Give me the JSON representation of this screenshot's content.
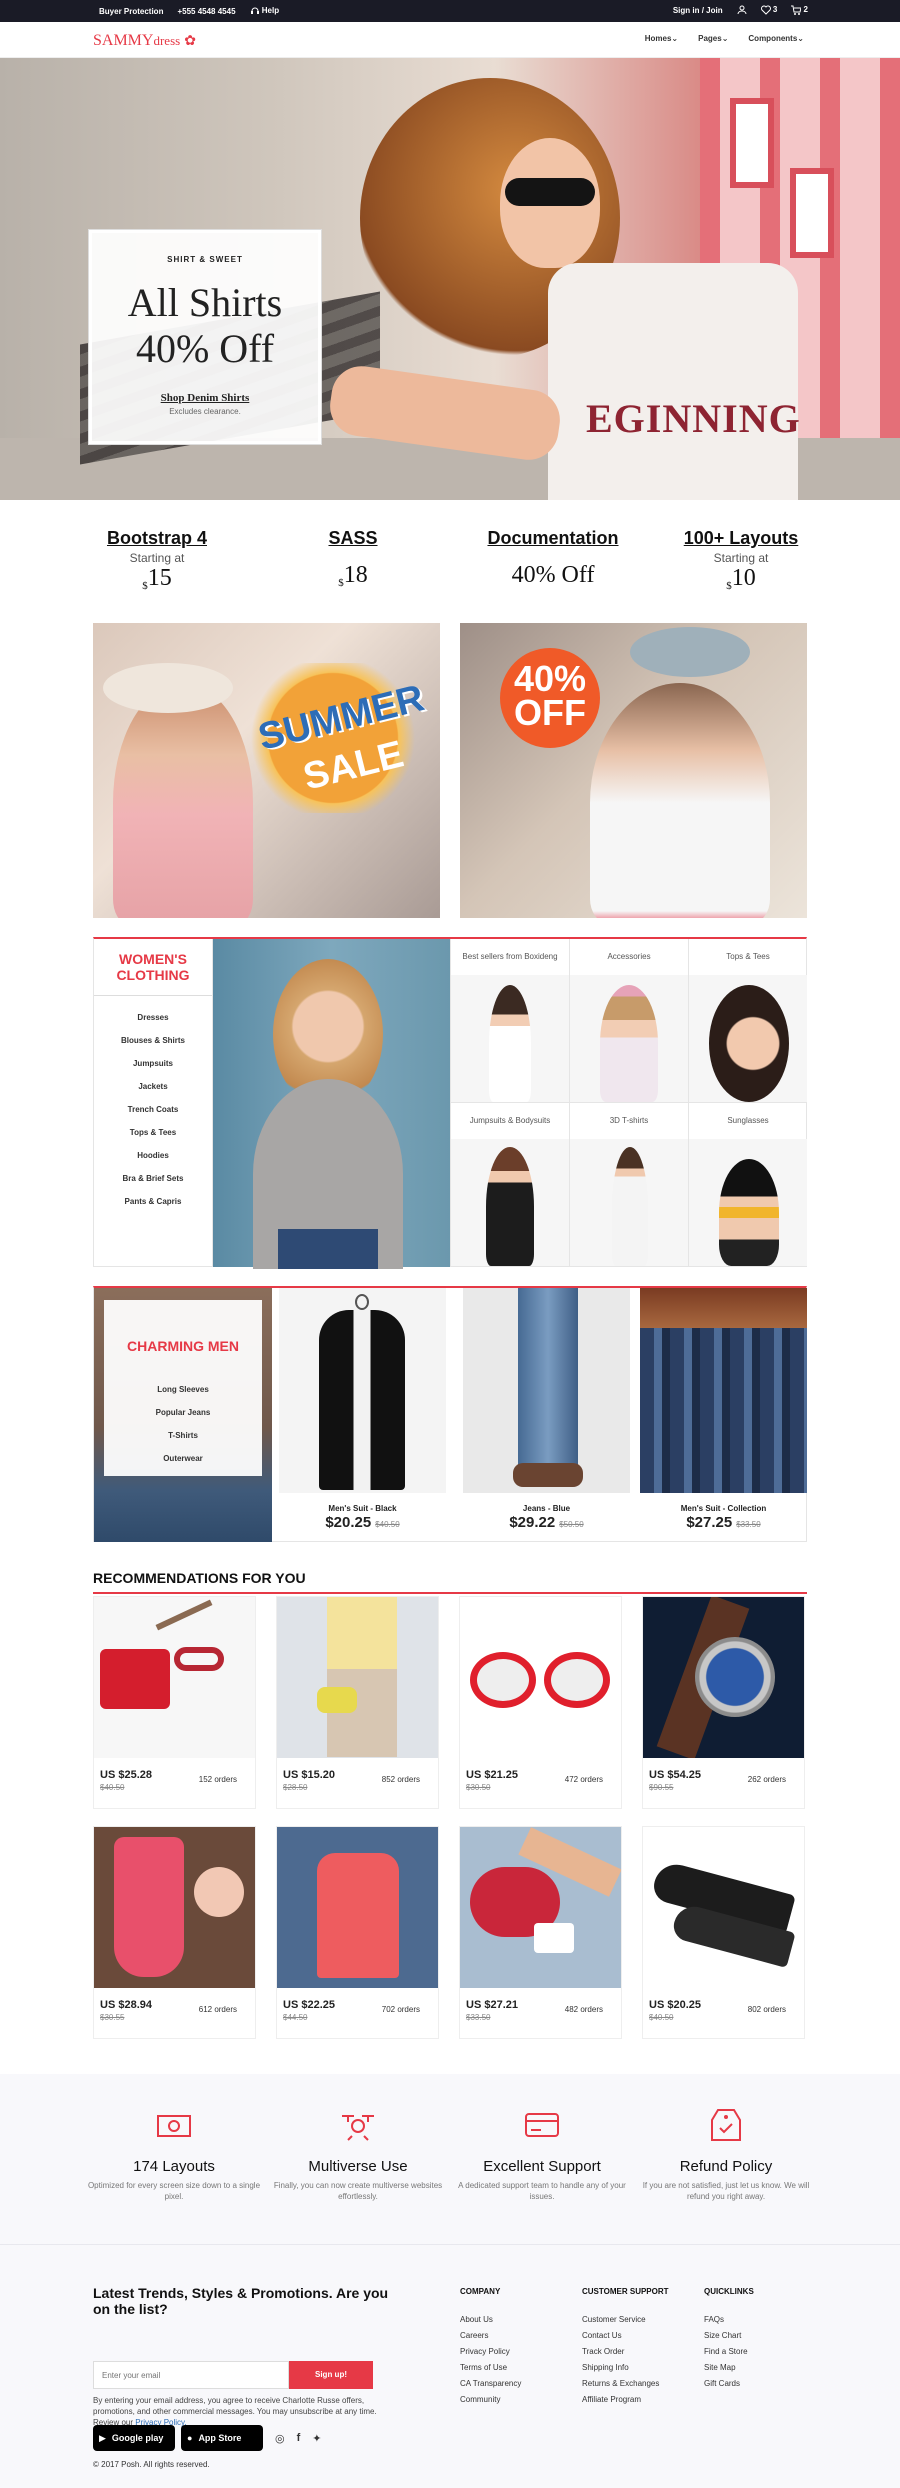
{
  "topbar": {
    "buyer_protection": "Buyer Protection",
    "phone": "+555 4548 4545",
    "help": "Help",
    "signin": "Sign in / Join",
    "wishlist_count": "3",
    "cart_count": "2"
  },
  "header": {
    "logo_main": "SAMMY",
    "logo_sub": "dress",
    "nav": [
      "Homes",
      "Pages",
      "Components"
    ]
  },
  "hero": {
    "kicker": "SHIRT & SWEET",
    "headline_1": "All Shirts",
    "headline_2": "40% Off",
    "link": "Shop Denim Shirts",
    "note": "Excludes clearance.",
    "shirt_print": "EGINNING"
  },
  "features": [
    {
      "title": "Bootstrap 4",
      "sub": "Starting at",
      "cur": "$",
      "price": "15"
    },
    {
      "title": "SASS",
      "sub": "",
      "cur": "$",
      "price": "18"
    },
    {
      "title": "Documentation",
      "sub": "",
      "cur": "",
      "price": "40% Off"
    },
    {
      "title": "100+ Layouts",
      "sub": "Starting at",
      "cur": "$",
      "price": "10"
    }
  ],
  "promos": {
    "summer_1": "SUMMER",
    "summer_2": "SALE",
    "off_1": "40%",
    "off_2": "OFF"
  },
  "women": {
    "title_1": "WOMEN'S",
    "title_2": "CLOTHING",
    "menu": [
      "Dresses",
      "Blouses & Shirts",
      "Jumpsuits",
      "Jackets",
      "Trench Coats",
      "Tops & Tees",
      "Hoodies",
      "Bra & Brief Sets",
      "Pants & Capris"
    ],
    "cells": [
      "Best sellers from Boxideng",
      "Accessories",
      "Tops & Tees",
      "Jumpsuits & Bodysuits",
      "3D T-shirts",
      "Sunglasses"
    ]
  },
  "men": {
    "title": "CHARMING MEN",
    "menu": [
      "Long Sleeves",
      "Popular Jeans",
      "T-Shirts",
      "Outerwear"
    ],
    "products": [
      {
        "name": "Men's Suit - Black",
        "price": "$20.25",
        "old": "$40.50"
      },
      {
        "name": "Jeans - Blue",
        "price": "$29.22",
        "old": "$50.50"
      },
      {
        "name": "Men's Suit - Collection",
        "price": "$27.25",
        "old": "$33.50"
      }
    ]
  },
  "recommendations": {
    "title": "RECOMMENDATIONS FOR YOU",
    "items": [
      {
        "price": "US $25.28",
        "old": "$40.50",
        "orders": "152 orders"
      },
      {
        "price": "US $15.20",
        "old": "$28.50",
        "orders": "852 orders"
      },
      {
        "price": "US $21.25",
        "old": "$30.50",
        "orders": "472 orders"
      },
      {
        "price": "US $54.25",
        "old": "$90.55",
        "orders": "262 orders"
      },
      {
        "price": "US $28.94",
        "old": "$30.55",
        "orders": "612 orders"
      },
      {
        "price": "US $22.25",
        "old": "$44.50",
        "orders": "702 orders"
      },
      {
        "price": "US $27.21",
        "old": "$33.50",
        "orders": "482 orders"
      },
      {
        "price": "US $20.25",
        "old": "$40.50",
        "orders": "802 orders"
      }
    ]
  },
  "services": [
    {
      "title": "174 Layouts",
      "text": "Optimized for every screen size down to a single pixel."
    },
    {
      "title": "Multiverse Use",
      "text": "Finally, you can now create multiverse websites effortlessly."
    },
    {
      "title": "Excellent Support",
      "text": "A dedicated support team to handle any of your issues."
    },
    {
      "title": "Refund Policy",
      "text": "If you are not satisfied, just let us know. We will refund you right away."
    }
  ],
  "footer": {
    "newsletter_title": "Latest Trends, Styles & Promotions. Are you on the list?",
    "email_placeholder": "Enter your email",
    "signup": "Sign up!",
    "disclaimer": "By entering your email address, you agree to receive Charlotte Russe offers, promotions, and other commercial messages. You may unsubscribe at any time. Review our",
    "privacy": "Privacy Policy.",
    "company_title": "COMPANY",
    "company": [
      "About Us",
      "Careers",
      "Privacy Policy",
      "Terms of Use",
      "CA Transparency",
      "Community"
    ],
    "support_title": "CUSTOMER SUPPORT",
    "support": [
      "Customer Service",
      "Contact Us",
      "Track Order",
      "Shipping Info",
      "Returns & Exchanges",
      "Affiliate Program"
    ],
    "quick_title": "QUICKLINKS",
    "quick": [
      "FAQs",
      "Size Chart",
      "Find a Store",
      "Site Map",
      "Gift Cards"
    ],
    "google_play": "Google play",
    "app_store": "App Store",
    "copyright": "© 2017 Posh. All rights reserved."
  },
  "colors": {
    "accent": "#e63946",
    "topbar": "#1a1b26"
  }
}
